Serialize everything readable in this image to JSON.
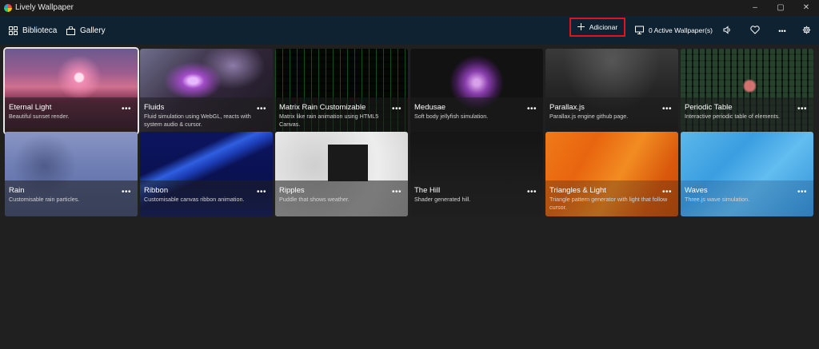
{
  "window": {
    "title": "Lively Wallpaper",
    "controls": [
      "–",
      "▢",
      "✕"
    ]
  },
  "nav": {
    "library_label": "Biblioteca",
    "gallery_label": "Gallery"
  },
  "toolbar": {
    "add_label": "Adicionar",
    "active_label": "0 Active Wallpaper(s)",
    "more_label": "•••"
  },
  "highlight_color": "#e0151b",
  "wallpapers": [
    {
      "title": "Eternal Light",
      "description": "Beautiful sunset render."
    },
    {
      "title": "Fluids",
      "description": "Fluid simulation using WebGL, reacts with system audio & cursor."
    },
    {
      "title": "Matrix Rain Customizable",
      "description": "Matrix like rain animation using HTML5 Canvas."
    },
    {
      "title": "Medusae",
      "description": "Soft body jellyfish simulation."
    },
    {
      "title": "Parallax.js",
      "description": "Parallax.js engine github page."
    },
    {
      "title": "Periodic Table",
      "description": "Interactive periodic table of elements."
    },
    {
      "title": "Rain",
      "description": "Customisable rain particles."
    },
    {
      "title": "Ribbon",
      "description": "Customisable canvas ribbon animation."
    },
    {
      "title": "Ripples",
      "description": "Puddle that shows weather."
    },
    {
      "title": "The Hill",
      "description": "Shader generated hill."
    },
    {
      "title": "Triangles & Light",
      "description": "Triangle pattern generator with light that follow cursor."
    },
    {
      "title": "Waves",
      "description": "Three.js wave simulation."
    }
  ]
}
